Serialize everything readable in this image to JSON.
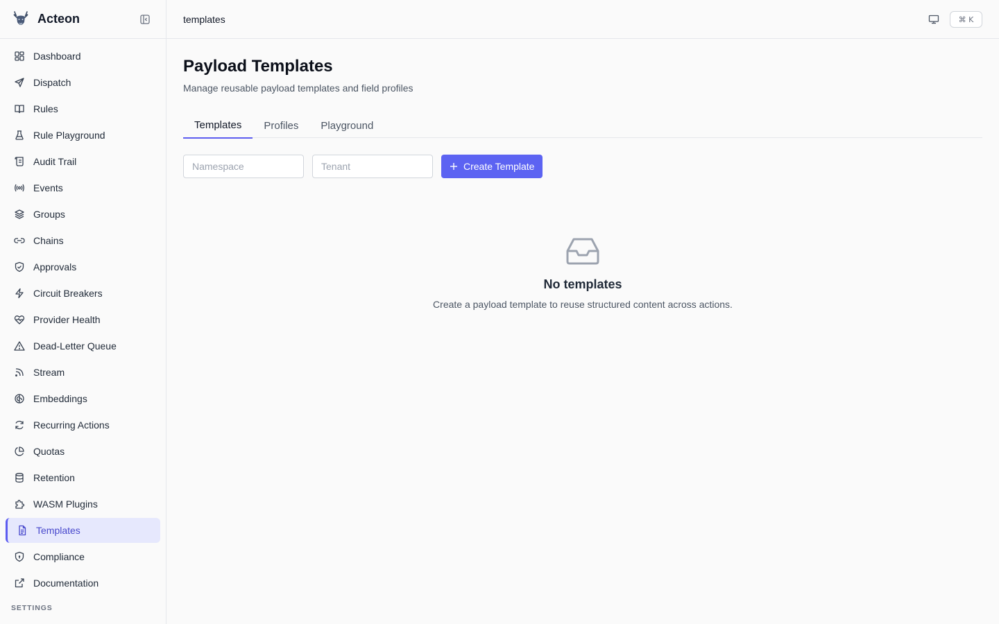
{
  "app": {
    "name": "Acteon",
    "logo_icon": "deer-head-icon"
  },
  "header": {
    "breadcrumb": "templates",
    "shortcut": "⌘ K"
  },
  "sidebar": {
    "items": [
      {
        "label": "Dashboard",
        "icon": "dashboard-icon"
      },
      {
        "label": "Dispatch",
        "icon": "send-icon"
      },
      {
        "label": "Rules",
        "icon": "book-icon"
      },
      {
        "label": "Rule Playground",
        "icon": "flask-icon"
      },
      {
        "label": "Audit Trail",
        "icon": "scroll-icon"
      },
      {
        "label": "Events",
        "icon": "radio-icon"
      },
      {
        "label": "Groups",
        "icon": "layers-icon"
      },
      {
        "label": "Chains",
        "icon": "link-icon"
      },
      {
        "label": "Approvals",
        "icon": "shield-check-icon"
      },
      {
        "label": "Circuit Breakers",
        "icon": "zap-icon"
      },
      {
        "label": "Provider Health",
        "icon": "heart-pulse-icon"
      },
      {
        "label": "Dead-Letter Queue",
        "icon": "alert-triangle-icon"
      },
      {
        "label": "Stream",
        "icon": "rss-icon"
      },
      {
        "label": "Embeddings",
        "icon": "brain-icon"
      },
      {
        "label": "Recurring Actions",
        "icon": "refresh-icon"
      },
      {
        "label": "Quotas",
        "icon": "pie-chart-icon"
      },
      {
        "label": "Retention",
        "icon": "database-icon"
      },
      {
        "label": "WASM Plugins",
        "icon": "puzzle-icon"
      },
      {
        "label": "Templates",
        "icon": "file-text-icon",
        "active": true
      },
      {
        "label": "Compliance",
        "icon": "shield-icon"
      },
      {
        "label": "Documentation",
        "icon": "external-link-icon"
      }
    ],
    "section_label": "SETTINGS"
  },
  "main": {
    "title": "Payload Templates",
    "subtitle": "Manage reusable payload templates and field profiles",
    "tabs": [
      {
        "label": "Templates",
        "active": true
      },
      {
        "label": "Profiles"
      },
      {
        "label": "Playground"
      }
    ],
    "filters": {
      "namespace_placeholder": "Namespace",
      "tenant_placeholder": "Tenant",
      "namespace_value": "",
      "tenant_value": ""
    },
    "create_button": "Create Template",
    "empty": {
      "icon": "inbox-icon",
      "title": "No templates",
      "description": "Create a payload template to reuse structured content across actions."
    }
  },
  "colors": {
    "accent": "#5c63f2",
    "active_bg": "#e6e8fd",
    "active_text": "#4747cc"
  }
}
